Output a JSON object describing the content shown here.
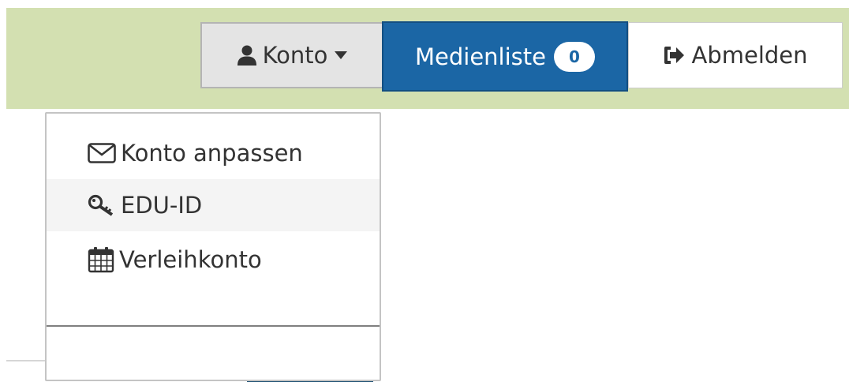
{
  "header": {
    "konto_label": "Konto",
    "medienliste_label": "Medienliste",
    "medienliste_count": "0",
    "abmelden_label": "Abmelden"
  },
  "dropdown": {
    "items": [
      {
        "label": "Konto anpassen",
        "icon": "envelope-icon"
      },
      {
        "label": "EDU-ID",
        "icon": "key-icon"
      },
      {
        "label": "Verleihkonto",
        "icon": "calendar-icon"
      }
    ]
  },
  "colors": {
    "header_bg": "#d3e0b1",
    "primary": "#1b66a5",
    "button_gray": "#e4e4e4",
    "menu_hover": "#f4f4f4"
  }
}
